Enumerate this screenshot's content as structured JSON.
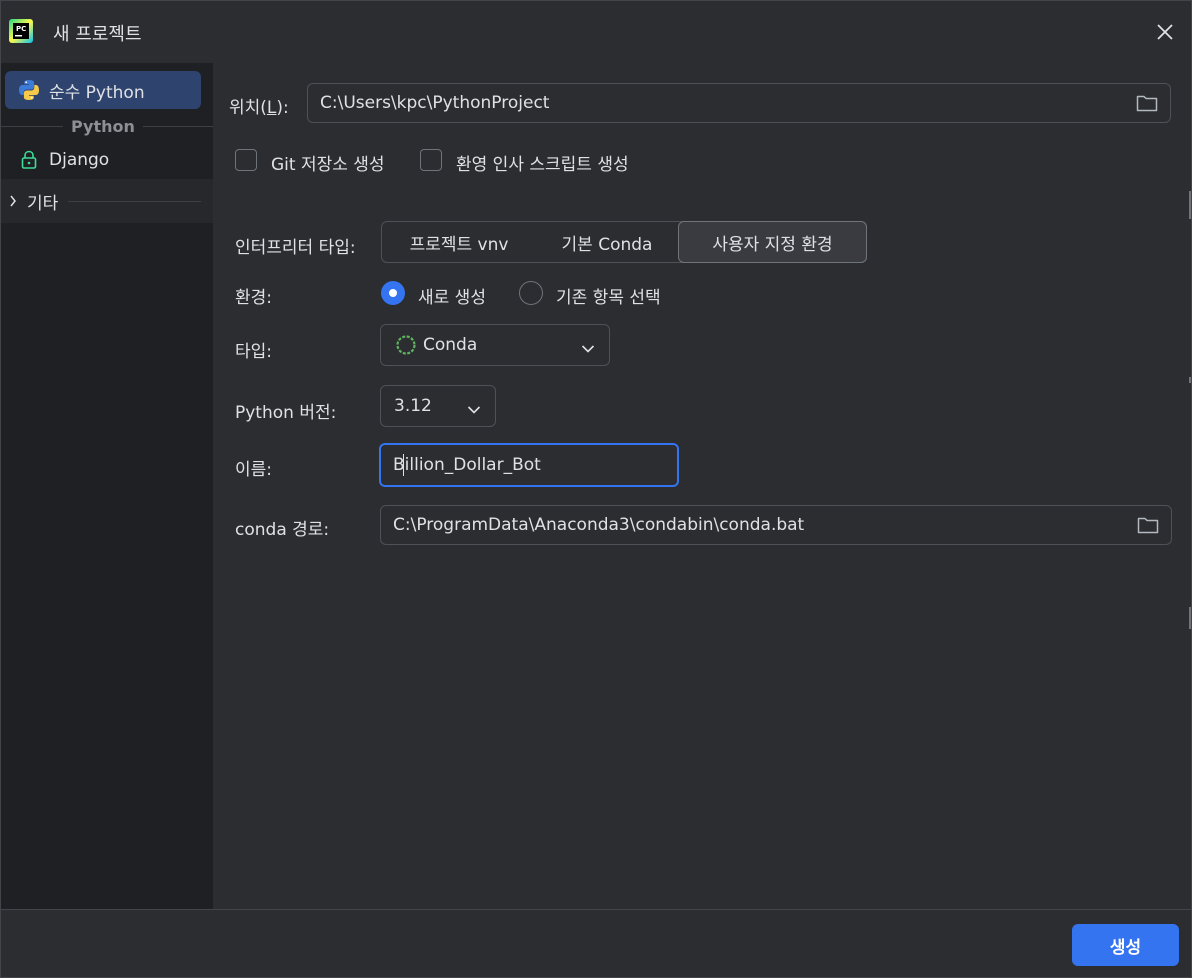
{
  "window": {
    "title": "새 프로젝트",
    "app_icon_text": "PC"
  },
  "sidebar": {
    "items": [
      {
        "label": "순수 Python",
        "icon": "python-icon",
        "selected": true
      },
      {
        "label": "Django",
        "icon": "lock-icon",
        "selected": false
      }
    ],
    "group_label": "Python",
    "other_label": "기타"
  },
  "form": {
    "location_label": "위치(",
    "location_mnemonic": "L",
    "location_suffix": "):",
    "location_value": "C:\\Users\\kpc\\PythonProject",
    "git_checkbox_label": "Git 저장소 생성",
    "git_checked": false,
    "welcome_checkbox_label": "환영 인사 스크립트 생성",
    "welcome_checked": false,
    "interpreter_type_label": "인터프리터 타입:",
    "interpreter_options": [
      "프로젝트 vnv",
      "기본 Conda",
      "사용자 지정 환경"
    ],
    "interpreter_selected": "사용자 지정 환경",
    "environment_label": "환경:",
    "environment_options": [
      "새로 생성",
      "기존 항목 선택"
    ],
    "environment_selected": "새로 생성",
    "type_label": "타입:",
    "type_value": "Conda",
    "python_version_label": "Python 버전:",
    "python_version_value": "3.12",
    "name_label": "이름:",
    "name_value": "Billion_Dollar_Bot",
    "conda_path_label": "conda 경로:",
    "conda_path_value": "C:\\ProgramData\\Anaconda3\\condabin\\conda.bat"
  },
  "footer": {
    "create_button": "생성"
  },
  "colors": {
    "accent": "#3574f0",
    "selected_item": "#2e436e",
    "background": "#2b2d30",
    "sidebar": "#1f2023",
    "conda_green": "#5fb25f"
  }
}
